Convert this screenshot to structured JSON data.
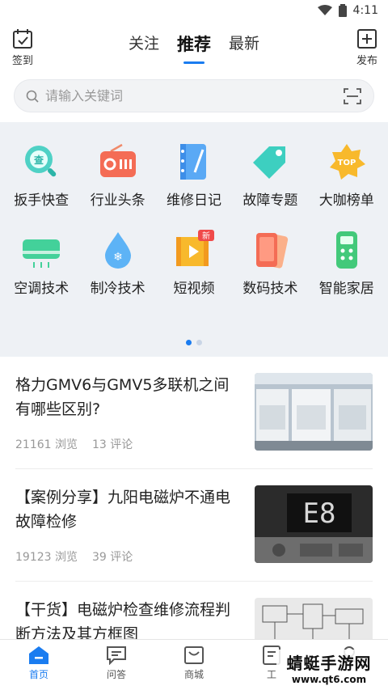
{
  "status_bar": {
    "time": "4:11"
  },
  "header": {
    "left_label": "签到",
    "right_label": "发布",
    "tabs": [
      {
        "label": "关注"
      },
      {
        "label": "推荐"
      },
      {
        "label": "最新"
      }
    ],
    "active_tab": "推荐"
  },
  "search": {
    "placeholder": "请输入关键词"
  },
  "grid": {
    "items": [
      {
        "label": "扳手快查",
        "icon": "wrench-search-icon"
      },
      {
        "label": "行业头条",
        "icon": "radio-icon"
      },
      {
        "label": "维修日记",
        "icon": "notebook-icon"
      },
      {
        "label": "故障专题",
        "icon": "tag-icon"
      },
      {
        "label": "大咖榜单",
        "icon": "top-badge-icon",
        "badge": "TOP"
      },
      {
        "label": "空调技术",
        "icon": "air-conditioner-icon"
      },
      {
        "label": "制冷技术",
        "icon": "water-drop-icon"
      },
      {
        "label": "短视频",
        "icon": "video-icon",
        "badge": "新"
      },
      {
        "label": "数码技术",
        "icon": "phone-icon"
      },
      {
        "label": "智能家居",
        "icon": "remote-icon"
      }
    ],
    "page_count": 2,
    "active_page": 1
  },
  "feed": [
    {
      "title": "格力GMV6与GMV5多联机之间有哪些区别?",
      "views": "21161 浏览",
      "comments": "13 评论",
      "image": "air-conditioner-units-photo"
    },
    {
      "title": "【案例分享】九阳电磁炉不通电故障检修",
      "views": "19123 浏览",
      "comments": "39 评论",
      "image": "e8-display-photo"
    },
    {
      "title": "【干货】电磁炉检查维修流程判断方法及其方框图",
      "views": "",
      "comments": "",
      "image": "circuit-diagram-photo"
    }
  ],
  "bottom_nav": [
    {
      "label": "首页",
      "active": true
    },
    {
      "label": "问答",
      "active": false
    },
    {
      "label": "商城",
      "active": false
    },
    {
      "label": "工",
      "active": false
    },
    {
      "label": "",
      "active": false
    }
  ],
  "watermark": {
    "title": "蜻蜓手游网",
    "url": "www.qt6.com"
  },
  "colors": {
    "accent": "#1a7cf0",
    "grid_bg": "#eef1f5"
  }
}
